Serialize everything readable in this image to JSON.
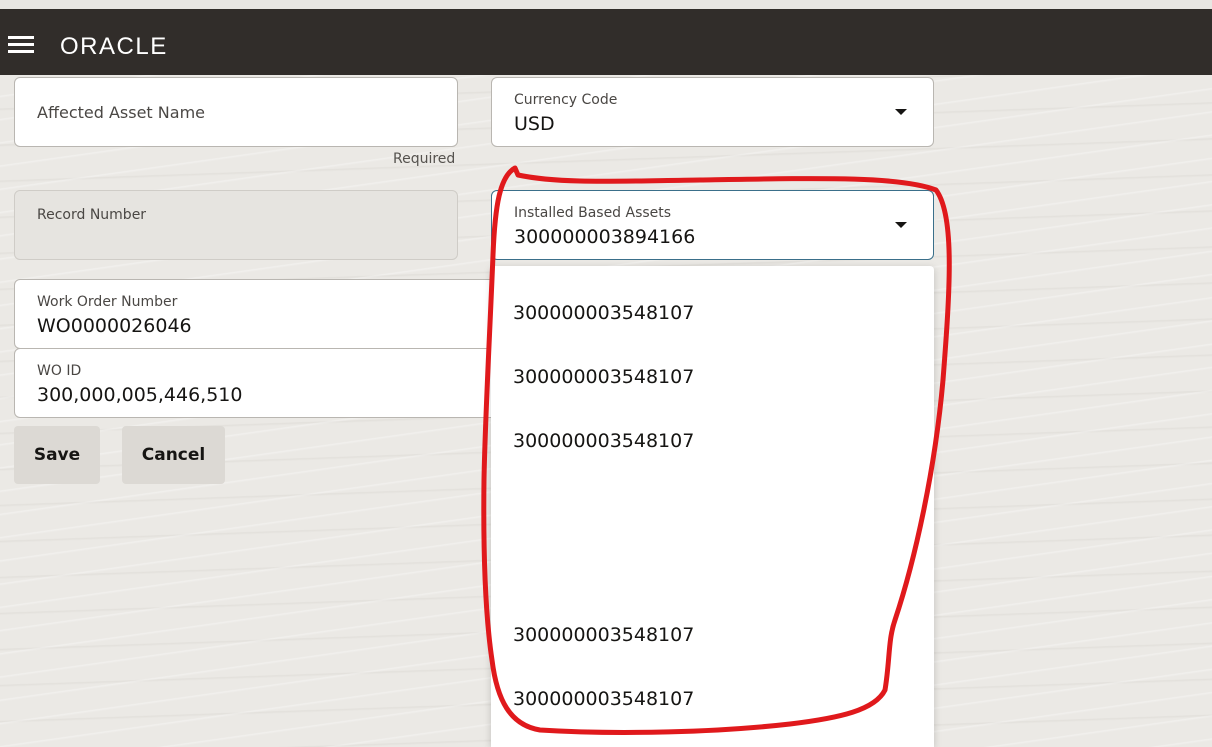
{
  "header": {
    "brand": "ORACLE",
    "menu_icon": "hamburger-menu-icon"
  },
  "form": {
    "affected_asset_name": {
      "label": "Affected Asset Name",
      "helper": "Required"
    },
    "currency_code": {
      "label": "Currency Code",
      "value": "USD"
    },
    "record_number": {
      "label": "Record Number",
      "value": ""
    },
    "installed_based_assets": {
      "label": "Installed Based Assets",
      "value": "300000003894166"
    },
    "work_order_number": {
      "label": "Work Order Number",
      "value": "WO0000026046"
    },
    "wo_id": {
      "label": "WO ID",
      "value": "300,000,005,446,510"
    }
  },
  "buttons": {
    "save": "Save",
    "cancel": "Cancel"
  },
  "dropdown": {
    "options": [
      "300000003548107",
      "300000003548107",
      "300000003548107",
      "300000003548107",
      "300000003548107"
    ]
  },
  "colors": {
    "header_bg": "#312d2a",
    "page_bg": "#ebe9e5",
    "focus_border": "#3a6f8a",
    "annotation": "#e0191c"
  }
}
